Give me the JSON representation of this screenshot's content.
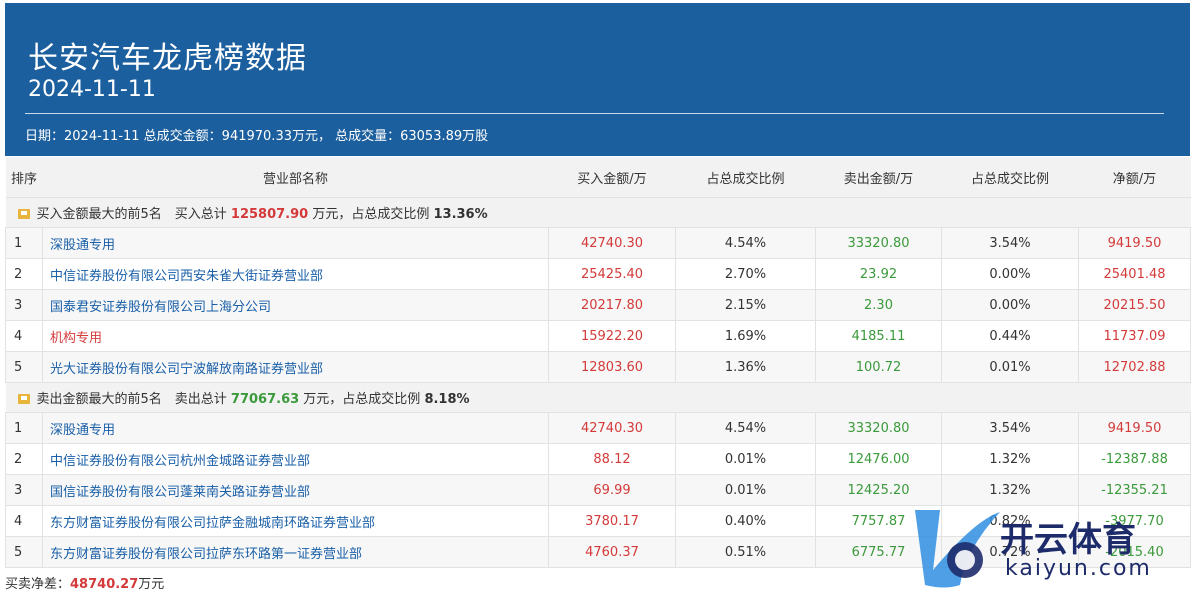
{
  "header": {
    "title": "长安汽车龙虎榜数据",
    "date": "2024-11-11",
    "summary": "日期：2024-11-11 总成交金额：941970.33万元， 总成交量：63053.89万股"
  },
  "table": {
    "columns": [
      "排序",
      "营业部名称",
      "买入金额/万",
      "占总成交比例",
      "卖出金额/万",
      "占总成交比例",
      "净额/万"
    ],
    "buy_group": {
      "prefix": "买入金额最大的前5名　买入总计 ",
      "total": "125807.90",
      "suffix": " 万元，占总成交比例 ",
      "ratio": "13.36%"
    },
    "buy_rows": [
      {
        "idx": "1",
        "name": "深股通专用",
        "buy": "42740.30",
        "buy_pct": "4.54%",
        "sell": "33320.80",
        "sell_pct": "3.54%",
        "net": "9419.50"
      },
      {
        "idx": "2",
        "name": "中信证券股份有限公司西安朱雀大街证券营业部",
        "buy": "25425.40",
        "buy_pct": "2.70%",
        "sell": "23.92",
        "sell_pct": "0.00%",
        "net": "25401.48"
      },
      {
        "idx": "3",
        "name": "国泰君安证券股份有限公司上海分公司",
        "buy": "20217.80",
        "buy_pct": "2.15%",
        "sell": "2.30",
        "sell_pct": "0.00%",
        "net": "20215.50"
      },
      {
        "idx": "4",
        "name": "机构专用",
        "buy": "15922.20",
        "buy_pct": "1.69%",
        "sell": "4185.11",
        "sell_pct": "0.44%",
        "net": "11737.09"
      },
      {
        "idx": "5",
        "name": "光大证券股份有限公司宁波解放南路证券营业部",
        "buy": "12803.60",
        "buy_pct": "1.36%",
        "sell": "100.72",
        "sell_pct": "0.01%",
        "net": "12702.88"
      }
    ],
    "sell_group": {
      "prefix": "卖出金额最大的前5名　卖出总计 ",
      "total": "77067.63",
      "suffix": " 万元，占总成交比例 ",
      "ratio": "8.18%"
    },
    "sell_rows": [
      {
        "idx": "1",
        "name": "深股通专用",
        "buy": "42740.30",
        "buy_pct": "4.54%",
        "sell": "33320.80",
        "sell_pct": "3.54%",
        "net": "9419.50"
      },
      {
        "idx": "2",
        "name": "中信证券股份有限公司杭州金城路证券营业部",
        "buy": "88.12",
        "buy_pct": "0.01%",
        "sell": "12476.00",
        "sell_pct": "1.32%",
        "net": "-12387.88"
      },
      {
        "idx": "3",
        "name": "国信证券股份有限公司蓬莱南关路证券营业部",
        "buy": "69.99",
        "buy_pct": "0.01%",
        "sell": "12425.20",
        "sell_pct": "1.32%",
        "net": "-12355.21"
      },
      {
        "idx": "4",
        "name": "东方财富证券股份有限公司拉萨金融城南环路证券营业部",
        "buy": "3780.17",
        "buy_pct": "0.40%",
        "sell": "7757.87",
        "sell_pct": "0.82%",
        "net": "-3977.70"
      },
      {
        "idx": "5",
        "name": "东方财富证券股份有限公司拉萨东环路第一证券营业部",
        "buy": "4760.37",
        "buy_pct": "0.51%",
        "sell": "6775.77",
        "sell_pct": "0.72%",
        "net": "-2015.40"
      }
    ]
  },
  "footer": {
    "label": "买卖净差：",
    "value": "48740.27",
    "unit": "万元"
  },
  "watermark": {
    "text": "开云体育",
    "sub": "kaiyun.com"
  },
  "colors": {
    "header_bg": "#1c5f9e",
    "buy_red": "#d43a3a",
    "sell_green": "#3b9a3b",
    "link_blue": "#1a5fa8"
  }
}
